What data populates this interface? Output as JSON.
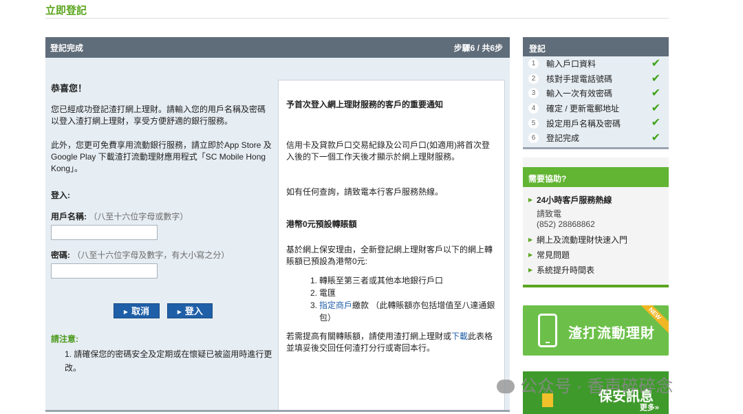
{
  "page": {
    "title": "立即登記"
  },
  "main": {
    "header_title": "登記完成",
    "step_indicator": "步驟6 / 共6步",
    "left": {
      "congrats": "恭喜您！",
      "para1": "您已經成功登記渣打網上理財。請輸入您的用戶名稱及密碼以登入渣打網上理財，享受方便舒適的銀行服務。",
      "para2": "此外，您更可免費享用流動銀行服務，請立即於App Store 及 Google Play 下載渣打流動理財應用程式「SC Mobile Hong Kong」。",
      "login_heading": "登入:",
      "username_label": "用戶名稱:",
      "username_hint": "（八至十六位字母或數字）",
      "username_value": "",
      "password_label": "密碼:",
      "password_hint": "（八至十六位字母及數字，有大小寫之分）",
      "password_value": "",
      "cancel_label": "取消",
      "login_label": "登入",
      "notice_title": "請注意:",
      "notice_items": [
        "1. 請確保您的密碼安全及定期或在懷疑已被盜用時進行更改。"
      ]
    },
    "right": {
      "heading": "予首次登入網上理財服務的客戶的重要通知",
      "para1": "信用卡及貸款戶口交易紀錄及公司戶口(如適用)將首次登入後的下一個工作天後才顯示於網上理財服務。",
      "para2": "如有任何查詢，請致電本行客戶服務熱線。",
      "limit_heading": "港幣0元預設轉賬額",
      "para3": "基於網上保安理由，全新登記網上理財客戶以下的網上轉賬額已預設為港幣0元:",
      "list": [
        {
          "num": "1.",
          "text": "轉賬至第三者或其他本地銀行戶口"
        },
        {
          "num": "2.",
          "text": "電匯"
        },
        {
          "num": "3.",
          "link": "指定商戶",
          "text": "繳款 （此轉賬額亦包括增值至八達通銀包）"
        }
      ],
      "para4_prefix": "若需提高有關轉賬額，請使用渣打網上理財或",
      "para4_link": "下載",
      "para4_suffix": "此表格並填妥後交回任何渣打分行或寄回本行。"
    }
  },
  "steps": {
    "title": "登記",
    "items": [
      {
        "num": "1",
        "label": "輸入戶口資料"
      },
      {
        "num": "2",
        "label": "核對手提電話號碼"
      },
      {
        "num": "3",
        "label": "輸入一次有效密碼"
      },
      {
        "num": "4",
        "label": "確定 / 更新電郵地址"
      },
      {
        "num": "5",
        "label": "設定用戶名稱及密碼"
      },
      {
        "num": "6",
        "label": "登記完成"
      }
    ],
    "check_glyph": "✔"
  },
  "help": {
    "title": "需要協助?",
    "hotline_title": "24小時客戶服務熱線",
    "hotline_line1": "請致電",
    "hotline_line2": "(852) 28868862",
    "links": [
      "網上及流動理財快速入門",
      "常見問題",
      "系統提升時間表"
    ]
  },
  "banners": {
    "mobile_text": "渣打流動理財",
    "new_badge": "NEW",
    "security_text": "保安訊息",
    "more_label": "更多»"
  },
  "watermark": {
    "text": "公众号 · 香声碎碎念"
  },
  "colors": {
    "accent_green": "#5aa51e",
    "header_gray": "#5f6c79",
    "button_blue": "#1f5fa8",
    "panel_bg": "#e6edf3"
  }
}
